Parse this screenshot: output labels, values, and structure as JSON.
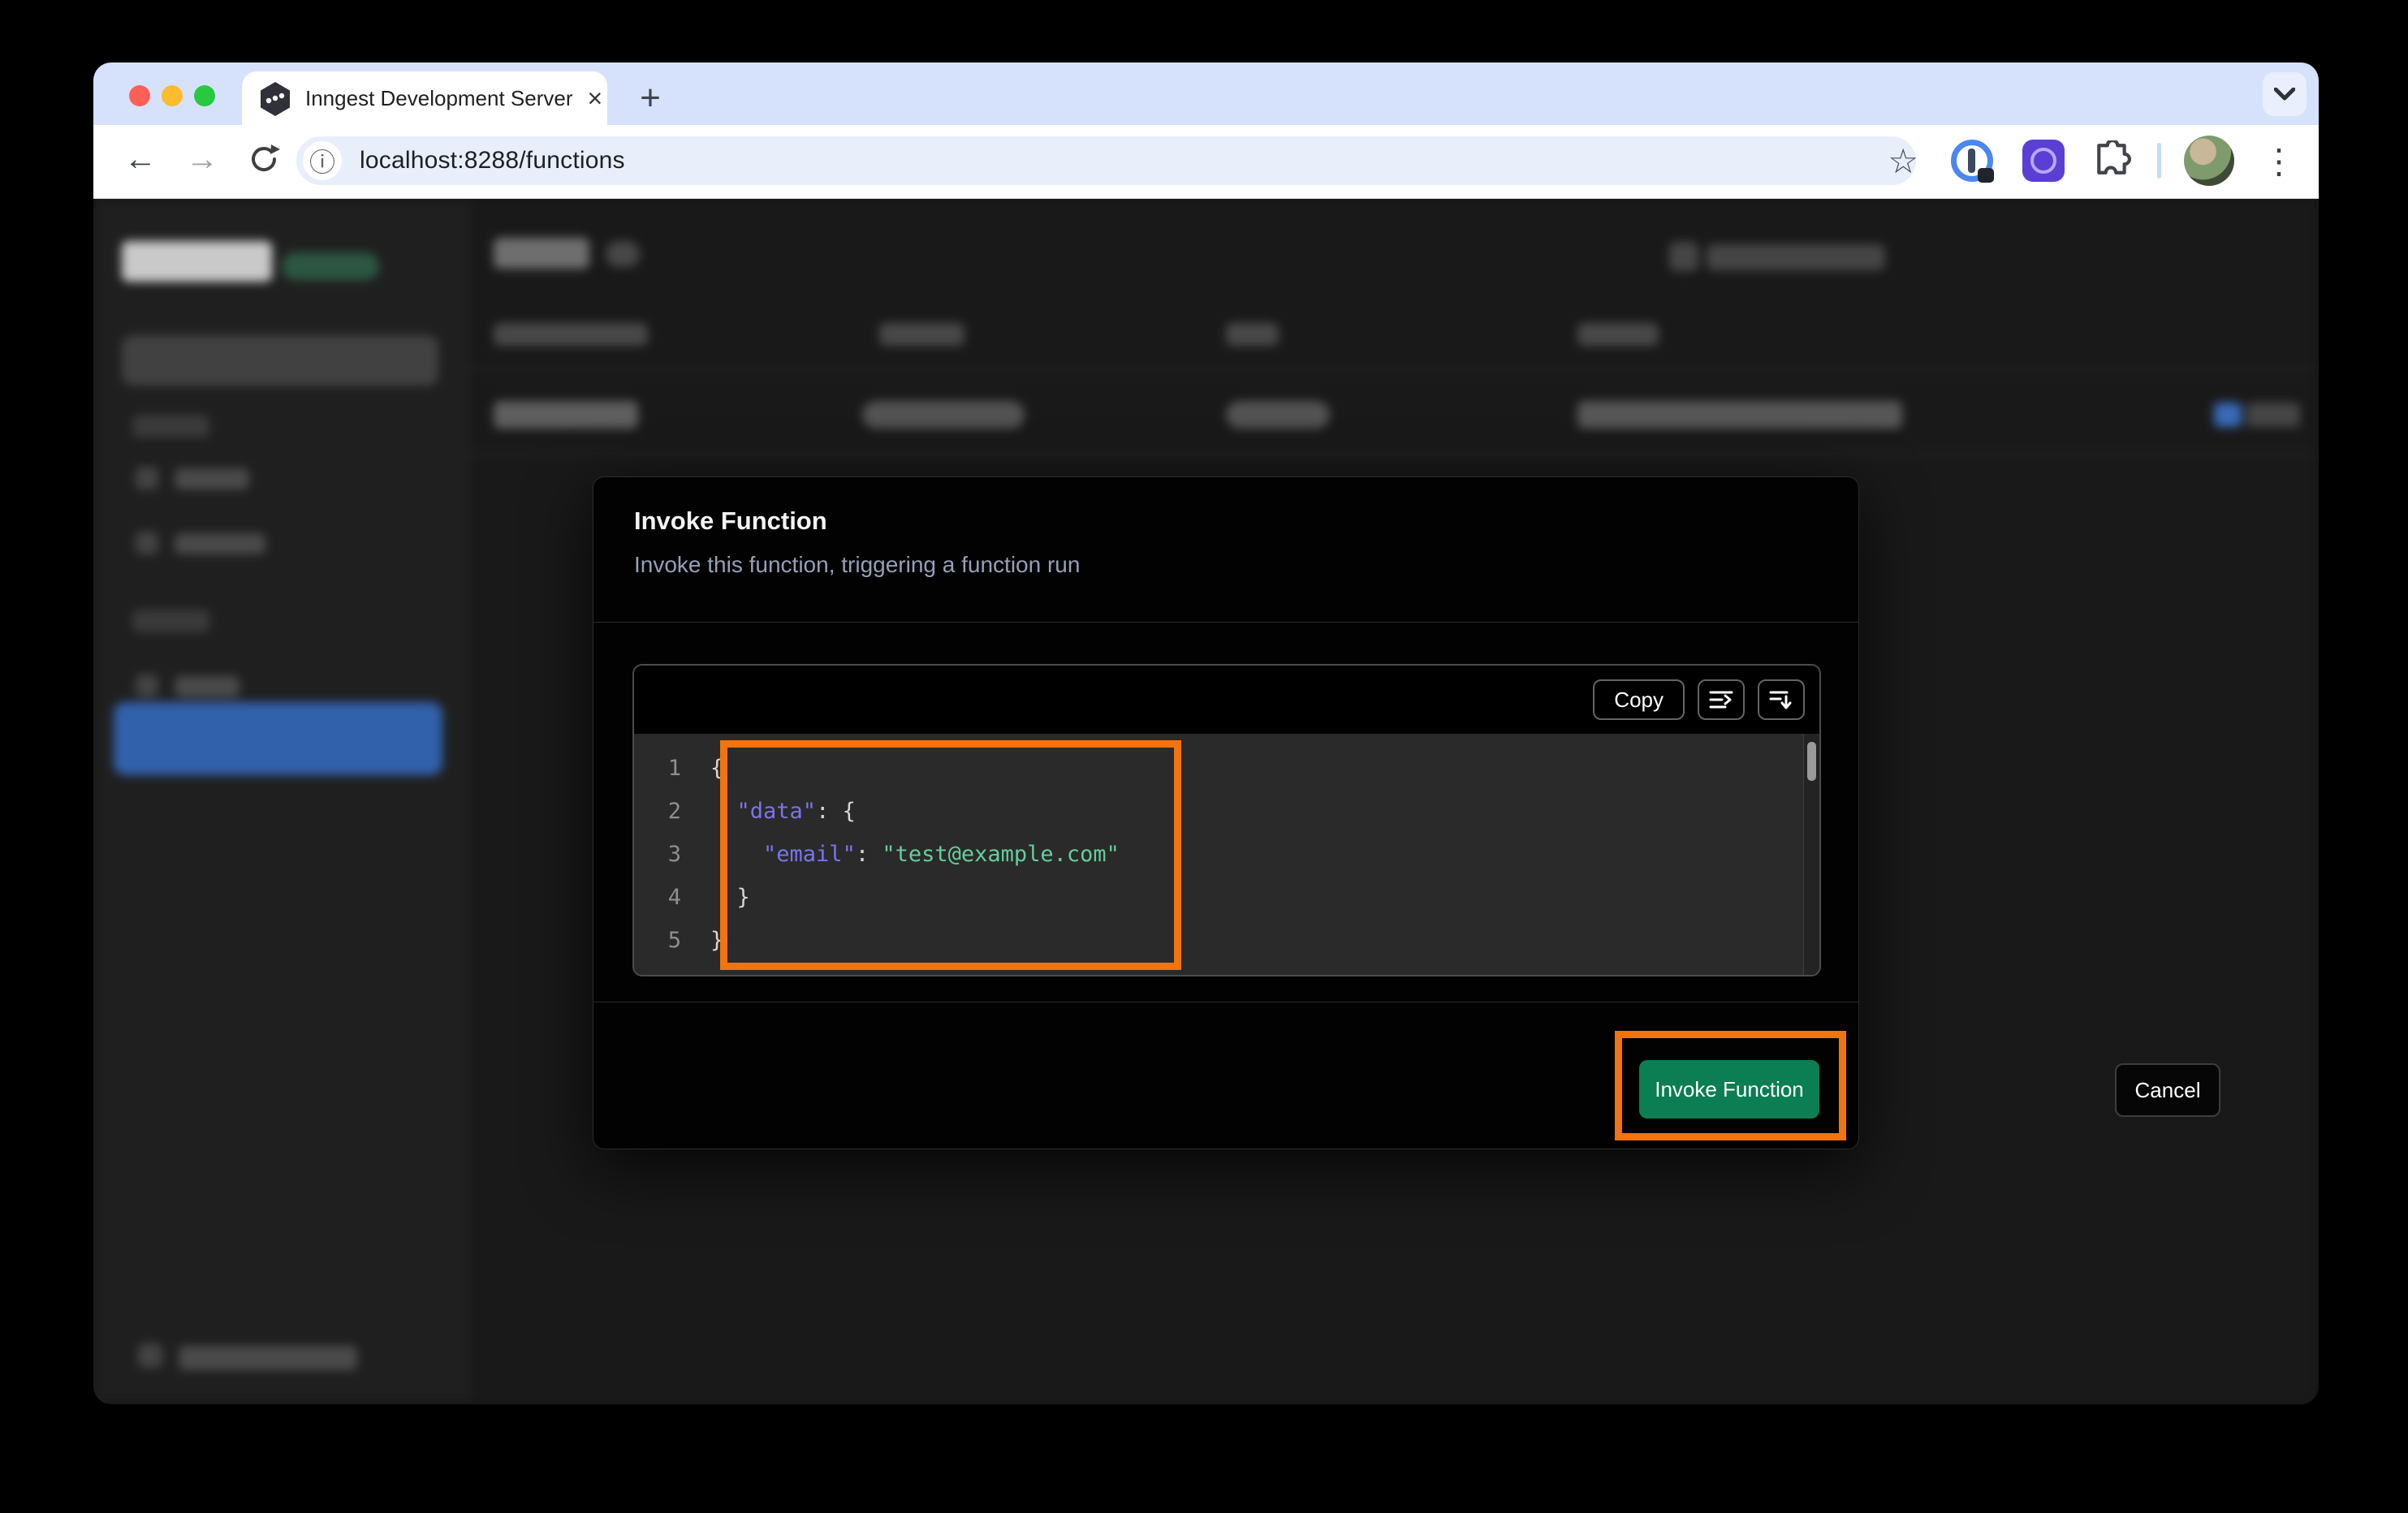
{
  "browser": {
    "tab_title": "Inngest Development Server",
    "tab_close_glyph": "×",
    "new_tab_glyph": "+",
    "back_glyph": "←",
    "forward_glyph": "→",
    "url": "localhost:8288/functions",
    "info_glyph": "ⓘ",
    "star_glyph": "☆",
    "menu_glyph": "⋮"
  },
  "modal": {
    "title": "Invoke Function",
    "subtitle": "Invoke this function, triggering a function run",
    "copy_label": "Copy",
    "cancel_label": "Cancel",
    "invoke_label": "Invoke Function"
  },
  "editor": {
    "lines": [
      {
        "num": "1",
        "tokens": [
          {
            "text": "{",
            "type": "punct"
          }
        ]
      },
      {
        "num": "2",
        "tokens": [
          {
            "text": "  ",
            "type": "punct"
          },
          {
            "text": "\"data\"",
            "type": "key"
          },
          {
            "text": ": {",
            "type": "punct"
          }
        ]
      },
      {
        "num": "3",
        "tokens": [
          {
            "text": "    ",
            "type": "punct"
          },
          {
            "text": "\"email\"",
            "type": "key"
          },
          {
            "text": ": ",
            "type": "punct"
          },
          {
            "text": "\"test@example.com\"",
            "type": "string"
          }
        ]
      },
      {
        "num": "4",
        "tokens": [
          {
            "text": "  }",
            "type": "punct"
          }
        ]
      },
      {
        "num": "5",
        "tokens": [
          {
            "text": "}",
            "type": "punct"
          }
        ]
      }
    ]
  },
  "colors": {
    "annotation_orange": "#F1740F",
    "invoke_green": "#0B7E53",
    "json_key": "#7A74F0",
    "json_string": "#63CF9B",
    "json_punct": "#D6D6D6",
    "subtitle": "#95A0B8",
    "selected_nav_blue": "#3261AC",
    "tabstrip_blue": "#D6E2FC",
    "code_background": "#2A2A2A"
  }
}
